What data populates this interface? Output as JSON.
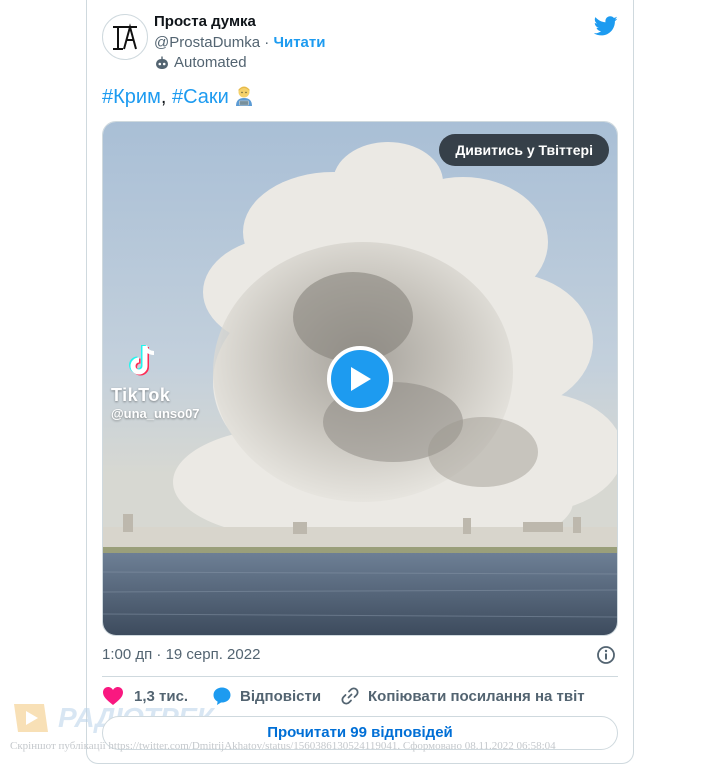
{
  "author": {
    "name": "Проста думка",
    "handle": "@ProstaDumka",
    "separator": " · ",
    "follow_label": "Читати",
    "automated_label": "Automated"
  },
  "tweet": {
    "hashtag1": "#Крим",
    "comma": ", ",
    "hashtag2": "#Саки",
    "emoji": "man-technologist-emoji"
  },
  "media": {
    "watch_label": "Дивитись у Твіттері",
    "tiktok_word": "TikTok",
    "tiktok_user": "@una_unso07"
  },
  "meta": {
    "timestamp": "1:00 дп · 19 серп. 2022"
  },
  "actions": {
    "likes": "1,3 тис.",
    "reply": "Відповісти",
    "copy_link": "Копіювати посилання на твіт"
  },
  "read_replies": "Прочитати 99 відповідей",
  "watermark": {
    "brand": "РАДІОТРЕК"
  },
  "footer": "Скріншот публікації https://twitter.com/DmitrijAkhatov/status/1560386130524119041. Сформовано 08.11.2022 06:58:04",
  "colors": {
    "accent": "#1d9bf0",
    "like": "#f91880",
    "muted": "#536471",
    "border": "#cfd9de"
  }
}
